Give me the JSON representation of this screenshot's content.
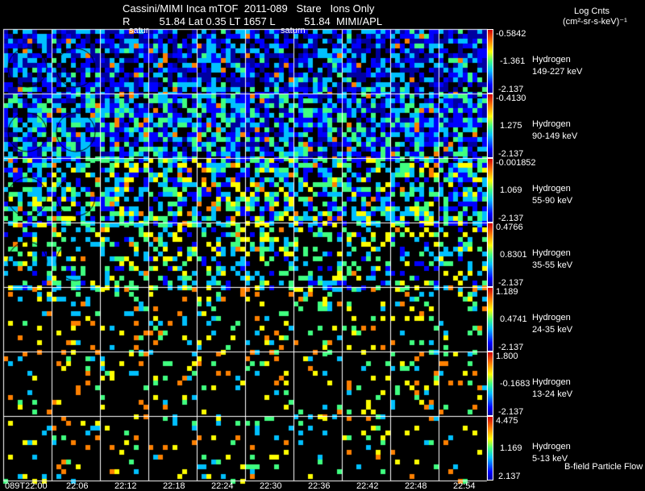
{
  "header": {
    "title": "Cassini/MIMI Inca mTOF  2011-089   Stare   Ions Only",
    "subtitle": "R          51.84 Lat 0.35 LT 1657 L          51.84  MIMI/APL",
    "marker_1": "satur",
    "marker_2": "saturn",
    "units_line1": "Log Cnts",
    "units_line2": "(cm²-sr-s-keV)⁻¹"
  },
  "footer": {
    "legend": "B-field Particle Flow"
  },
  "chart_data": {
    "type": "heatmap",
    "title": "Cassini/MIMI Inca mTOF  2011-089   Stare   Ions Only",
    "x_tick_labels": [
      "089T22:00",
      "22:06",
      "22:12",
      "22:18",
      "22:24",
      "22:30",
      "22:36",
      "22:42",
      "22:48",
      "22:54"
    ],
    "colormap": [
      "#0000a0",
      "#0000ff",
      "#00c0ff",
      "#40ff80",
      "#ffff00",
      "#ff8000",
      "#d00000"
    ],
    "rows": [
      {
        "species": "Hydrogen",
        "energy": "149-227 keV",
        "max": "-0.5842",
        "mid": "-1.361",
        "min": "-2.137",
        "density": 0.75,
        "bias": 0.2
      },
      {
        "species": "Hydrogen",
        "energy": "90-149 keV",
        "max": "-0.4130",
        "mid": "1.275",
        "min": "-2.137",
        "density": 0.8,
        "bias": 0.3
      },
      {
        "species": "Hydrogen",
        "energy": "55-90 keV",
        "max": "-0.001852",
        "mid": "1.069",
        "min": "-2.137",
        "density": 0.6,
        "bias": 0.4
      },
      {
        "species": "Hydrogen",
        "energy": "35-55 keV",
        "max": "0.4766",
        "mid": "0.8301",
        "min": "-2.137",
        "density": 0.35,
        "bias": 0.45
      },
      {
        "species": "Hydrogen",
        "energy": "24-35 keV",
        "max": "1.189",
        "mid": "0.4741",
        "min": "-2.137",
        "density": 0.15,
        "bias": 0.55
      },
      {
        "species": "Hydrogen",
        "energy": "13-24 keV",
        "max": "1.800",
        "mid": "-0.1683",
        "min": "-2.137",
        "density": 0.13,
        "bias": 0.58
      },
      {
        "species": "Hydrogen",
        "energy": "5-13 keV",
        "max": "4.475",
        "mid": "1.169",
        "min": "2.137",
        "density": 0.1,
        "bias": 0.55
      }
    ]
  }
}
